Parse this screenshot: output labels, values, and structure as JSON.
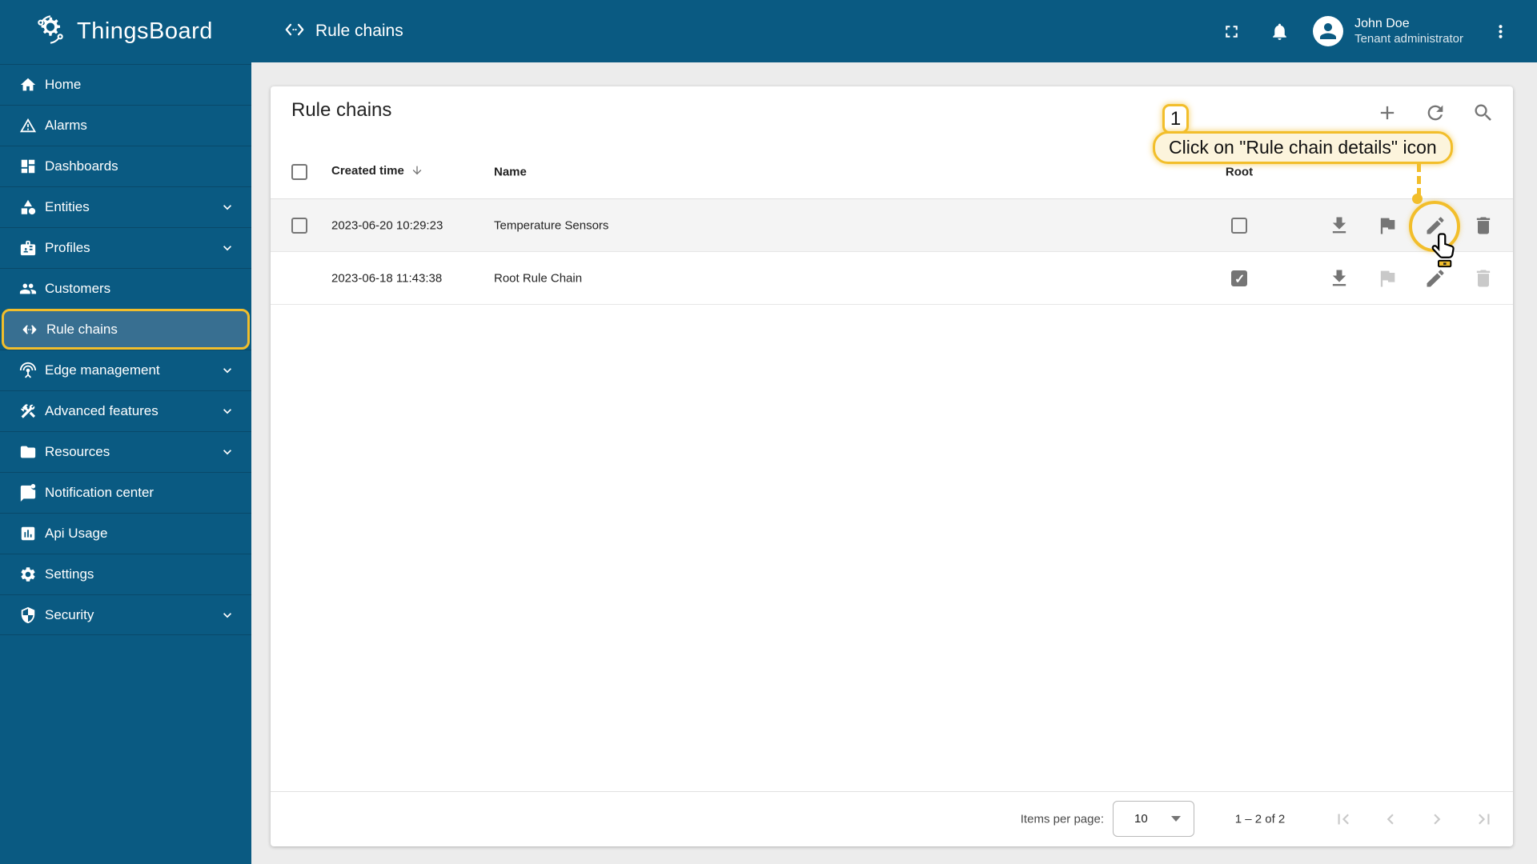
{
  "brand": {
    "name": "ThingsBoard",
    "logo_icon": "thingsboard-bug-gear-icon"
  },
  "topbar": {
    "title": "Rule chains",
    "title_icon": "rule-chain-icon",
    "icons": [
      "fullscreen-icon",
      "notifications-bell-icon",
      "more-vert-icon"
    ],
    "user": {
      "name": "John Doe",
      "role": "Tenant administrator",
      "avatar_icon": "person-icon"
    }
  },
  "sidebar": {
    "items": [
      {
        "label": "Home",
        "icon": "home-icon",
        "expandable": false,
        "active": false
      },
      {
        "label": "Alarms",
        "icon": "warning-icon",
        "expandable": false,
        "active": false
      },
      {
        "label": "Dashboards",
        "icon": "dashboard-icon",
        "expandable": false,
        "active": false
      },
      {
        "label": "Entities",
        "icon": "category-icon",
        "expandable": true,
        "active": false
      },
      {
        "label": "Profiles",
        "icon": "badge-icon",
        "expandable": true,
        "active": false
      },
      {
        "label": "Customers",
        "icon": "people-icon",
        "expandable": false,
        "active": false
      },
      {
        "label": "Rule chains",
        "icon": "rule-chain-icon",
        "expandable": false,
        "active": true
      },
      {
        "label": "Edge management",
        "icon": "antenna-icon",
        "expandable": true,
        "active": false
      },
      {
        "label": "Advanced features",
        "icon": "construction-icon",
        "expandable": true,
        "active": false
      },
      {
        "label": "Resources",
        "icon": "folder-icon",
        "expandable": true,
        "active": false
      },
      {
        "label": "Notification center",
        "icon": "chat-unread-icon",
        "expandable": false,
        "active": false
      },
      {
        "label": "Api Usage",
        "icon": "chart-icon",
        "expandable": false,
        "active": false
      },
      {
        "label": "Settings",
        "icon": "gear-icon",
        "expandable": false,
        "active": false
      },
      {
        "label": "Security",
        "icon": "shield-icon",
        "expandable": true,
        "active": false
      }
    ]
  },
  "page": {
    "card_title": "Rule chains",
    "toolbar_icons": [
      "add-icon",
      "refresh-icon",
      "search-icon"
    ],
    "table": {
      "headers": {
        "created_time": "Created time",
        "name": "Name",
        "root": "Root"
      },
      "sort": {
        "column": "created_time",
        "direction": "desc",
        "icon": "arrow-downward-icon"
      },
      "row_action_icons": [
        "download-icon",
        "flag-icon",
        "edit-pencil-icon",
        "delete-trash-icon"
      ],
      "rows": [
        {
          "created_time": "2023-06-20 10:29:23",
          "name": "Temperature Sensors",
          "root": false,
          "selectable": true,
          "disabled_actions": []
        },
        {
          "created_time": "2023-06-18 11:43:38",
          "name": "Root Rule Chain",
          "root": true,
          "selectable": false,
          "disabled_actions": [
            "flag-icon",
            "delete-trash-icon"
          ]
        }
      ]
    },
    "pagination": {
      "items_per_page_label": "Items per page:",
      "page_size": "10",
      "range_label": "1 – 2 of 2",
      "nav_icons": [
        "first-page-icon",
        "prev-page-icon",
        "next-page-icon",
        "last-page-icon"
      ],
      "nav_disabled": true
    }
  },
  "annotation": {
    "step": "1",
    "label": "Click on \"Rule chain details\" icon",
    "target": "rule-chain-details-edit-icon",
    "pointer_icon": "hand-cursor-icon"
  },
  "colors": {
    "primary_blue": "#0A5A82",
    "active_item_bg": "#386F91",
    "accent_gold": "#F2BE2B",
    "tooltip_bg": "#FCF4DC",
    "content_bg": "#ECECEC",
    "row_highlight_bg": "#F4F4F4",
    "icon_grey": "#757575",
    "icon_disabled": "#C9C9C9"
  }
}
